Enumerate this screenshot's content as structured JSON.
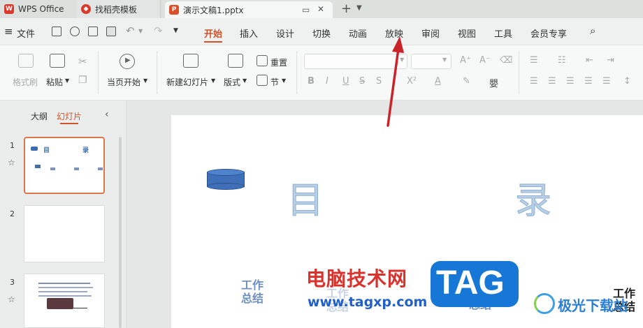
{
  "tabs": {
    "wps": "WPS Office",
    "template": "找稻壳模板",
    "doc": "演示文稿1.pptx",
    "new_tab": "+"
  },
  "menu": {
    "file": "文件",
    "items": [
      "开始",
      "插入",
      "设计",
      "切换",
      "动画",
      "放映",
      "审阅",
      "视图",
      "工具",
      "会员专享"
    ],
    "active": "开始"
  },
  "ribbon": {
    "format_painter": "格式刷",
    "paste": "粘贴",
    "from_current": "当页开始",
    "new_slide": "新建幻灯片",
    "layout": "版式",
    "reset": "重置",
    "section": "节"
  },
  "sidebar": {
    "outline_tab": "大纲",
    "slides_tab": "幻灯片",
    "slides": [
      {
        "num": "1",
        "title_a": "目",
        "title_b": "录"
      },
      {
        "num": "2"
      },
      {
        "num": "3"
      }
    ]
  },
  "slide": {
    "char1": "目",
    "char2": "录",
    "item1_line1": "工作",
    "item1_line2": "总结",
    "item2_line1": "工作",
    "item2_line2": "总结",
    "item3_line2": "总结",
    "item4_line1": "工作",
    "item4_line2": "总结"
  },
  "watermark": {
    "site_cn": "电脑技术网",
    "tag": "TAG",
    "url": "www.tagxp.com",
    "right_logo": "极光下载站"
  },
  "colors": {
    "accent": "#d2522a",
    "wps_red": "#d93a2b",
    "tag_blue": "#1677d6",
    "arrow_red": "#c8242a"
  }
}
